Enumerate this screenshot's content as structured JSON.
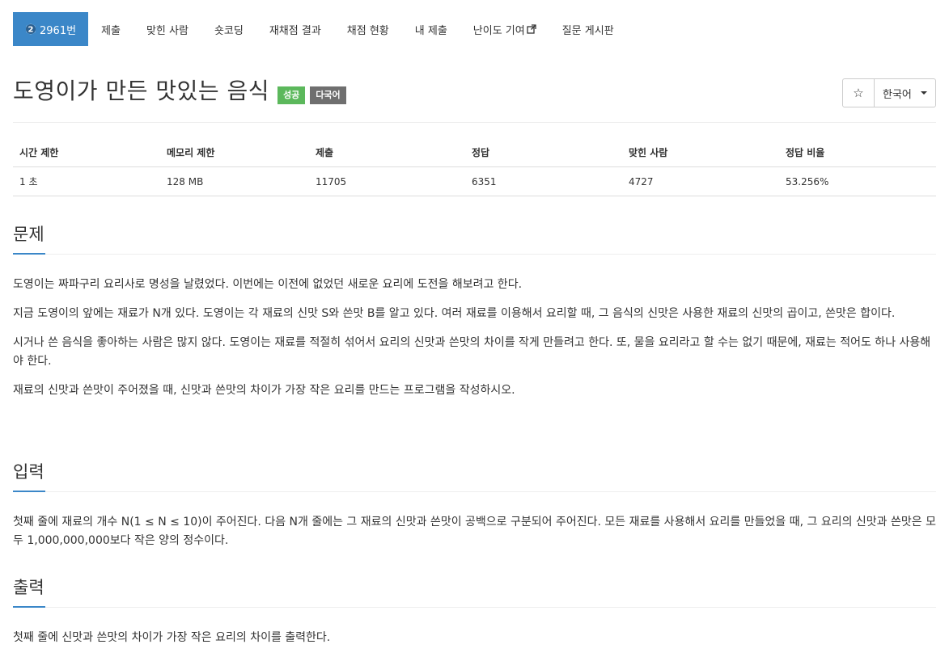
{
  "nav": {
    "tabs": [
      {
        "label": "2961번",
        "active": true
      },
      {
        "label": "제출"
      },
      {
        "label": "맞힌 사람"
      },
      {
        "label": "숏코딩"
      },
      {
        "label": "재채점 결과"
      },
      {
        "label": "채점 현황"
      },
      {
        "label": "내 제출"
      },
      {
        "label": "난이도 기여"
      },
      {
        "label": "질문 게시판"
      }
    ],
    "tier_badge_number": "2"
  },
  "problem": {
    "title": "도영이가 만든 맛있는 음식",
    "labels": [
      "성공",
      "다국어"
    ]
  },
  "controls": {
    "star_icon": "☆",
    "language": "한국어"
  },
  "info_table": {
    "headers": [
      "시간 제한",
      "메모리 제한",
      "제출",
      "정답",
      "맞힌 사람",
      "정답 비율"
    ],
    "values": [
      "1 초",
      "128 MB",
      "11705",
      "6351",
      "4727",
      "53.256%"
    ]
  },
  "sections": {
    "description": {
      "title": "문제",
      "paragraphs": [
        "도영이는 짜파구리 요리사로 명성을 날렸었다. 이번에는 이전에 없었던 새로운 요리에 도전을 해보려고 한다.",
        "지금 도영이의 앞에는 재료가 N개 있다. 도영이는 각 재료의 신맛 S와 쓴맛 B를 알고 있다. 여러 재료를 이용해서 요리할 때, 그 음식의 신맛은 사용한 재료의 신맛의 곱이고, 쓴맛은 합이다.",
        "시거나 쓴 음식을 좋아하는 사람은 많지 않다. 도영이는 재료를 적절히 섞어서 요리의 신맛과 쓴맛의 차이를 작게 만들려고 한다. 또, 물을 요리라고 할 수는 없기 때문에, 재료는 적어도 하나 사용해야 한다.",
        "재료의 신맛과 쓴맛이 주어졌을 때, 신맛과 쓴맛의 차이가 가장 작은 요리를 만드는 프로그램을 작성하시오."
      ]
    },
    "input": {
      "title": "입력",
      "paragraphs": [
        "첫째 줄에 재료의 개수 N(1 ≤ N ≤ 10)이 주어진다. 다음 N개 줄에는 그 재료의 신맛과 쓴맛이 공백으로 구분되어 주어진다. 모든 재료를 사용해서 요리를 만들었을 때, 그 요리의 신맛과 쓴맛은 모두 1,000,000,000보다 작은 양의 정수이다."
      ]
    },
    "output": {
      "title": "출력",
      "paragraphs": [
        "첫째 줄에 신맛과 쓴맛의 차이가 가장 작은 요리의 차이를 출력한다."
      ]
    }
  },
  "colors": {
    "primary": "#3b87c8",
    "success": "#5cb85c",
    "label_gray": "#6f6f6f"
  }
}
